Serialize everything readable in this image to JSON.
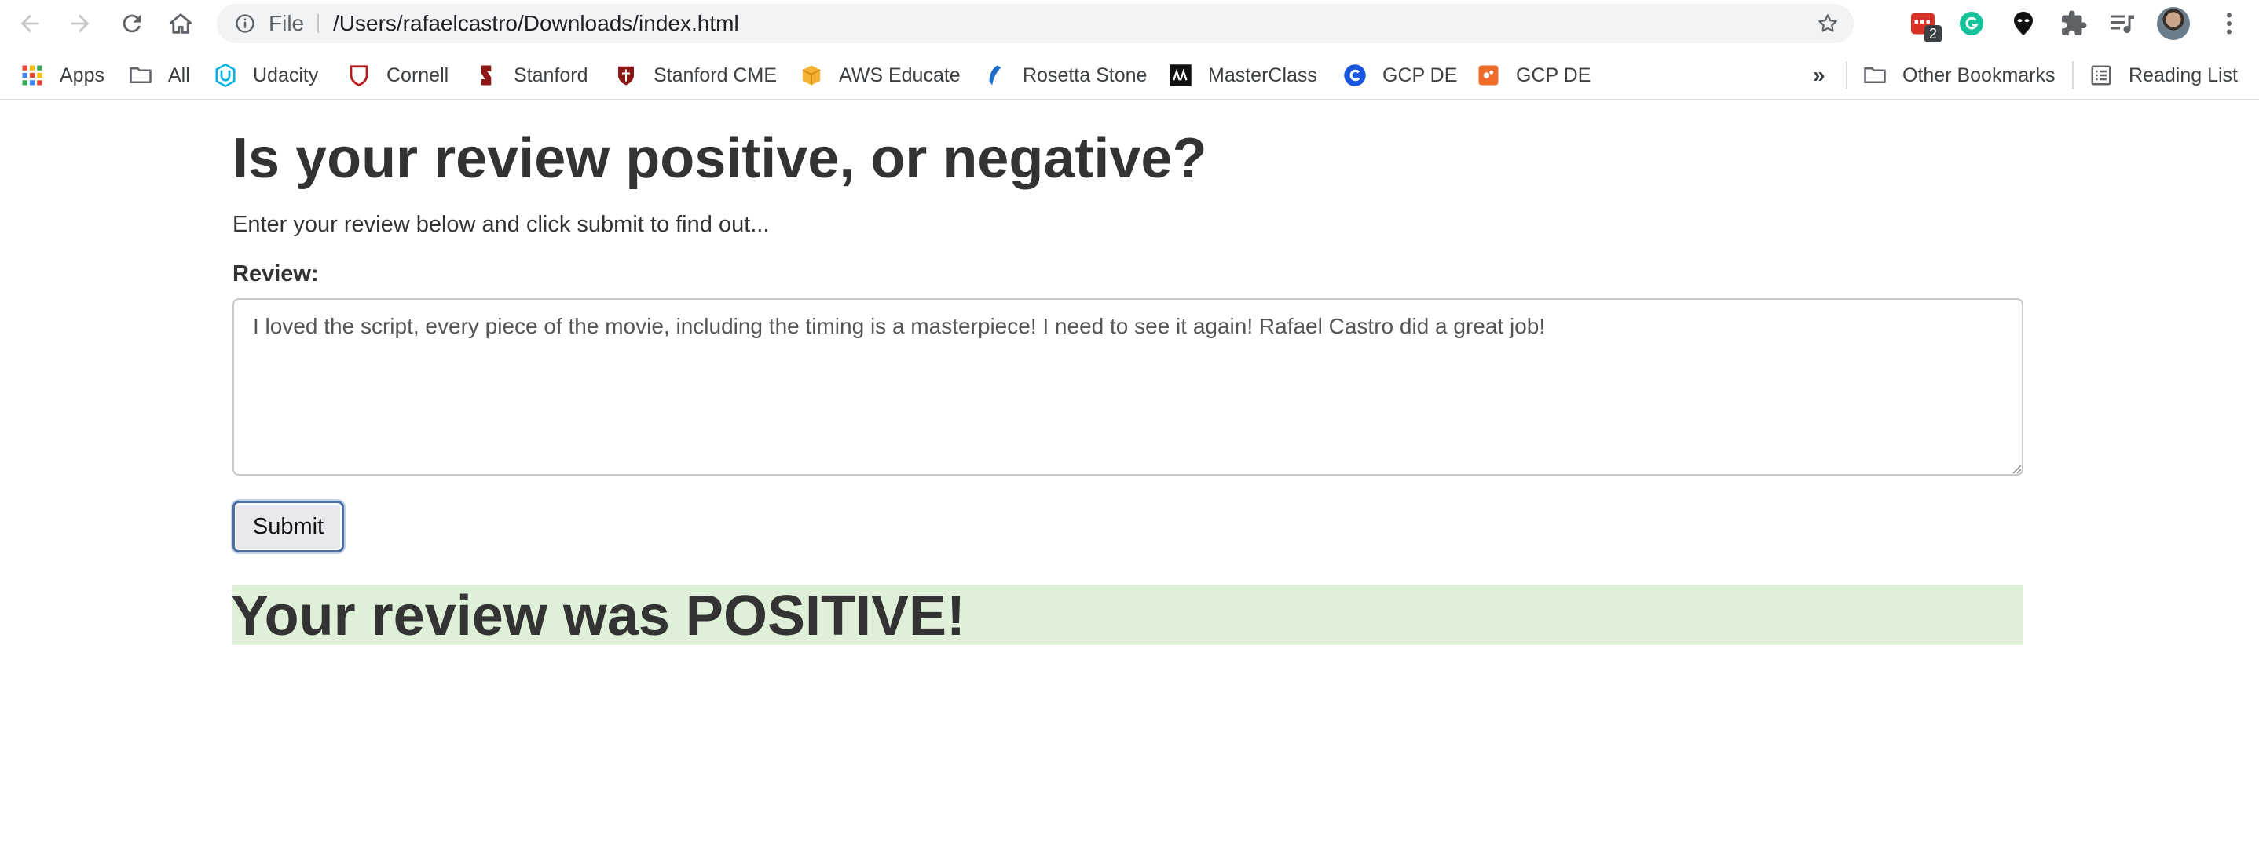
{
  "browser": {
    "address_scheme_label": "File",
    "address_url": "/Users/rafaelcastro/Downloads/index.html",
    "extension_badge_count": "2"
  },
  "bookmarks": {
    "items": [
      {
        "label": "Apps",
        "icon": "apps-grid-icon"
      },
      {
        "label": "All",
        "icon": "folder-icon"
      },
      {
        "label": "Udacity",
        "icon": "udacity-icon"
      },
      {
        "label": "Cornell",
        "icon": "cornell-shield-icon"
      },
      {
        "label": "Stanford",
        "icon": "stanford-icon"
      },
      {
        "label": "Stanford CME",
        "icon": "stanford-shield-icon"
      },
      {
        "label": "AWS Educate",
        "icon": "aws-box-icon"
      },
      {
        "label": "Rosetta Stone",
        "icon": "rosetta-stone-icon"
      },
      {
        "label": "MasterClass",
        "icon": "masterclass-icon"
      },
      {
        "label": "GCP DE",
        "icon": "gcp-c-icon"
      },
      {
        "label": "GCP DE",
        "icon": "gcp-orange-icon"
      }
    ],
    "overflow_label": "»",
    "other_bookmarks_label": "Other Bookmarks",
    "reading_list_label": "Reading List"
  },
  "page": {
    "title": "Is your review positive, or negative?",
    "subtitle": "Enter your review below and click submit to find out...",
    "review_label": "Review:",
    "review_text": "I loved the script, every piece of the movie, including the timing is a masterpiece! I need to see it again! Rafael Castro did a great job!",
    "submit_label": "Submit",
    "result_text": "Your review was POSITIVE!"
  },
  "colors": {
    "result_background": "#dff0d8",
    "text": "#333333",
    "submit_border": "#4a6fa5"
  }
}
